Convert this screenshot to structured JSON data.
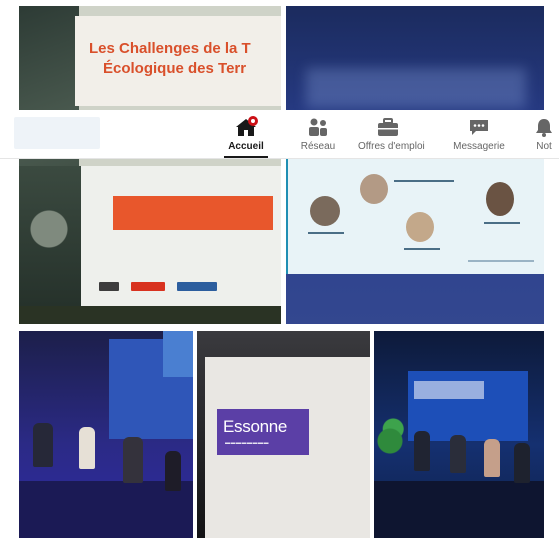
{
  "banner": {
    "line1": "Les Challenges de la T",
    "line2": "Écologique des Terr"
  },
  "nav": {
    "items": [
      {
        "id": "home",
        "label": "Accueil",
        "icon": "home-icon",
        "active": true
      },
      {
        "id": "network",
        "label": "Réseau",
        "icon": "network-icon",
        "active": false
      },
      {
        "id": "jobs",
        "label": "Offres d'emploi",
        "icon": "briefcase-icon",
        "active": false
      },
      {
        "id": "messaging",
        "label": "Messagerie",
        "icon": "chat-icon",
        "active": false
      },
      {
        "id": "notifications",
        "label": "Not",
        "icon": "bell-icon",
        "active": false
      }
    ]
  },
  "logo_tile": {
    "brand": "Essonne"
  },
  "colors": {
    "accent_orange": "#e8572c",
    "brand_purple": "#5b3fa6",
    "notification_red": "#cc1016",
    "stage_blue": "#2f56b8"
  }
}
